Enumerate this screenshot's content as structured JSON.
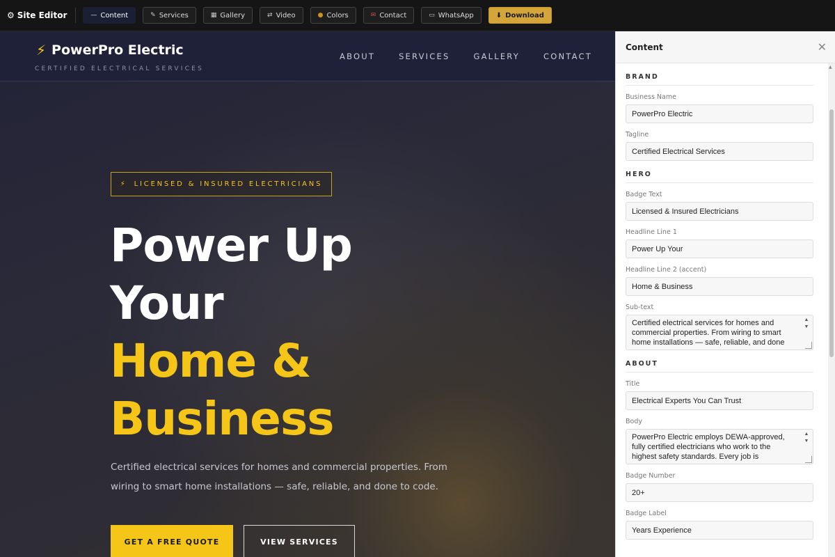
{
  "toolbar": {
    "brand": "Site Editor",
    "buttons": [
      {
        "label": "Content",
        "icon": "—"
      },
      {
        "label": "Services",
        "icon": "✎"
      },
      {
        "label": "Gallery",
        "icon": "▦"
      },
      {
        "label": "Video",
        "icon": "⇄"
      },
      {
        "label": "Colors",
        "icon": "●"
      },
      {
        "label": "Contact",
        "icon": "✉"
      },
      {
        "label": "WhatsApp",
        "icon": "▭"
      }
    ],
    "download_label": "Download"
  },
  "site": {
    "logo": "PowerPro Electric",
    "tagline": "Certified Electrical Services",
    "nav": [
      "ABOUT",
      "SERVICES",
      "GALLERY",
      "CONTACT"
    ],
    "badge": "Licensed & Insured Electricians",
    "headline_1a": "Power Up",
    "headline_1b": "Your",
    "headline_2a": "Home &",
    "headline_2b": "Business",
    "subtext_line1": "Certified electrical services for homes and commercial properties. From",
    "subtext_line2": "wiring to smart home installations — safe, reliable, and done to code.",
    "cta_primary": "GET A FREE QUOTE",
    "cta_secondary": "VIEW SERVICES"
  },
  "panel": {
    "title": "Content",
    "brand_section": "Brand",
    "business_name_label": "Business Name",
    "business_name": "PowerPro Electric",
    "tagline_label": "Tagline",
    "tagline": "Certified Electrical Services",
    "hero_section": "Hero",
    "badge_label": "Badge Text",
    "badge_text": "Licensed & Insured Electricians",
    "headline1_label": "Headline Line 1",
    "headline1": "Power Up Your",
    "headline2_label": "Headline Line 2 (accent)",
    "headline2": "Home & Business",
    "subtext_label": "Sub-text",
    "subtext_line1": "Certified electrical services for homes and",
    "subtext_line2": "commercial properties. From wiring to smart",
    "subtext_line3": "home installations — safe, reliable, and done",
    "about_section": "About",
    "about_title_label": "Title",
    "about_title": "Electrical Experts You Can Trust",
    "body_label": "Body",
    "body_line1": "PowerPro Electric employs DEWA-approved,",
    "body_line2": "fully certified electricians who work to the",
    "body_line3": "highest safety standards. Every job is",
    "badge_number_label": "Badge Number",
    "badge_number": "20+",
    "badge_label_label": "Badge Label",
    "badge_label_value": "Years Experience"
  },
  "colors": {
    "accent": "#f5c518",
    "header_bg": "#1f2138",
    "download_btn": "#d4a63a"
  }
}
